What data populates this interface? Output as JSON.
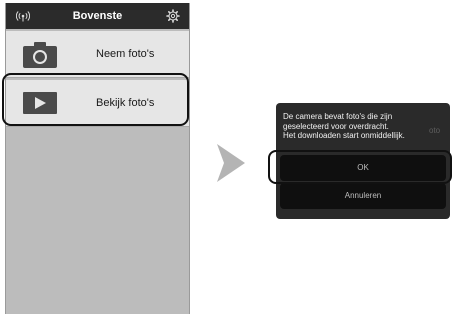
{
  "header": {
    "title": "Bovenste",
    "left_icon": "wifi-icon",
    "right_icon": "gear-icon"
  },
  "menu": [
    {
      "label": "Neem foto's",
      "icon": "camera-icon"
    },
    {
      "label": "Bekijk foto's",
      "icon": "play-icon"
    }
  ],
  "dialog": {
    "lines": [
      "De camera bevat foto's die zijn",
      "geselecteerd voor overdracht.",
      "Het downloaden start onmiddellijk."
    ],
    "ghost_text": "oto",
    "ok_label": "OK",
    "cancel_label": "Annuleren"
  },
  "colors": {
    "header_bg": "#2b2b2b",
    "list_bg": "#bcbcbc",
    "item_bg": "#e6e6e6",
    "dialog_bg": "#2a2a2a",
    "arrow": "#b4b4b4"
  }
}
